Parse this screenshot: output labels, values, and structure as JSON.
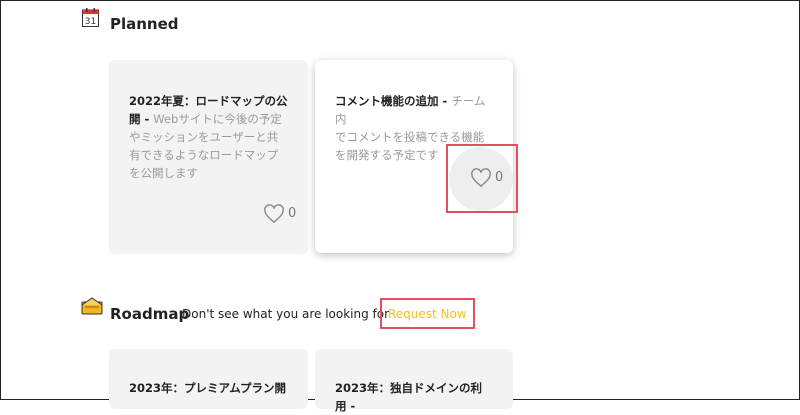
{
  "planned": {
    "title": "Planned",
    "cards": [
      {
        "bold_lines": [
          "2022年夏：ロードマップの公",
          "開 - "
        ],
        "desc_lines": [
          "Webサイトに今後の予定",
          "やミッションをユーザーと共",
          "有できるようなロードマップ",
          "を公開します"
        ],
        "likes": "0"
      },
      {
        "bold_lines": [
          "コメント機能の追加 - "
        ],
        "desc_lines": [
          "チーム内",
          "でコメントを投稿できる機能",
          "を開発する予定です"
        ],
        "likes": "0"
      }
    ]
  },
  "roadmap": {
    "title": "Roadmap",
    "subtitle": "Don't see what you are looking for",
    "request_label": "Request Now",
    "cards": [
      {
        "bold": "2023年：プレミアムプラン開"
      },
      {
        "bold": "2023年：独自ドメインの利用 -"
      }
    ]
  },
  "icons": {
    "calendar": "calendar-icon",
    "roadmap": "road-sign-icon",
    "heart": "heart-icon"
  },
  "colors": {
    "highlight": "#e24f5f",
    "request": "#f0c020",
    "card_bg": "#f3f3f3"
  }
}
